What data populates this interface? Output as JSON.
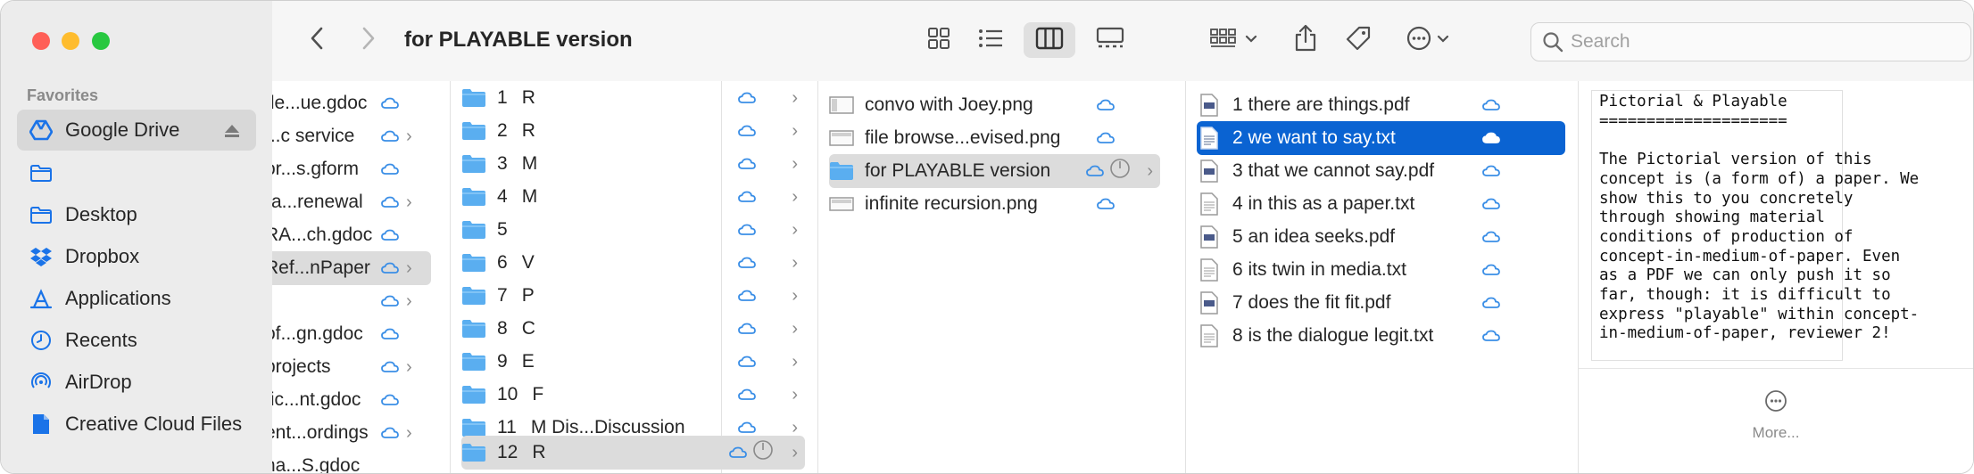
{
  "window": {
    "title": "for PLAYABLE version"
  },
  "search": {
    "placeholder": "Search"
  },
  "toolbar": {
    "back_icon": "chevron-left-icon",
    "forward_icon": "chevron-right-icon",
    "views": [
      "icon-view",
      "list-view",
      "column-view",
      "gallery-view"
    ],
    "selected_view": "column-view"
  },
  "sidebar": {
    "section": "Favorites",
    "items": [
      {
        "label": "Google Drive",
        "icon": "google-drive-icon"
      },
      {
        "label": "",
        "icon": "folder-icon"
      },
      {
        "label": "Desktop",
        "icon": "folder-icon"
      },
      {
        "label": "Dropbox",
        "icon": "dropbox-icon"
      },
      {
        "label": "Applications",
        "icon": "applications-icon"
      },
      {
        "label": "Recents",
        "icon": "clock-icon"
      },
      {
        "label": "AirDrop",
        "icon": "airdrop-icon"
      },
      {
        "label": "Creative Cloud Files",
        "icon": "document-icon"
      }
    ]
  },
  "columns": {
    "col1": [
      {
        "label": "fle...ue.gdoc"
      },
      {
        "label": "...c service"
      },
      {
        "label": "or...s.gform"
      },
      {
        "label": "ra...renewal"
      },
      {
        "label": "RA...ch.gdoc"
      },
      {
        "label": "Ref...nPaper"
      },
      {
        "label": ""
      },
      {
        "label": "of...gn.gdoc"
      },
      {
        "label": "projects"
      },
      {
        "label": "tic...nt.gdoc"
      },
      {
        "label": "ent...ordings"
      },
      {
        "label": "na...S.gdoc"
      }
    ],
    "col2": [
      {
        "num": "1",
        "label": "R"
      },
      {
        "num": "2",
        "label": "R"
      },
      {
        "num": "3",
        "label": "M"
      },
      {
        "num": "4",
        "label": "M"
      },
      {
        "num": "5",
        "label": ""
      },
      {
        "num": "6",
        "label": "V"
      },
      {
        "num": "7",
        "label": "P"
      },
      {
        "num": "8",
        "label": "C"
      },
      {
        "num": "9",
        "label": "E"
      },
      {
        "num": "10",
        "label": "F"
      },
      {
        "num": "11",
        "label": "M   Dis...Discussion"
      },
      {
        "num": "12",
        "label": "R"
      }
    ],
    "col3": [
      {
        "label": "convo with Joey.png"
      },
      {
        "label": "file browse...evised.png"
      },
      {
        "label": "for PLAYABLE version"
      },
      {
        "label": "infinite recursion.png"
      }
    ],
    "col4": [
      {
        "label": "1 there are things.pdf"
      },
      {
        "label": "2 we want to say.txt"
      },
      {
        "label": "3 that we cannot say.pdf"
      },
      {
        "label": "4 in this as a paper.txt"
      },
      {
        "label": "5 an idea seeks.pdf"
      },
      {
        "label": "6 its twin in media.txt"
      },
      {
        "label": "7 does the fit fit.pdf"
      },
      {
        "label": "8 is the dialogue legit.txt"
      }
    ]
  },
  "preview": {
    "text": "Pictorial & Playable\n====================\n\nThe Pictorial version of this\nconcept is (a form of) a paper. We\nshow this to you concretely\nthrough showing material\nconditions of production of\nconcept-in-medium-of-paper. Even\nas a PDF we can only push it so\nfar, though: it is difficult to\nexpress \"playable\" within concept-\nin-medium-of-paper, reviewer 2!",
    "more_label": "More..."
  },
  "colors": {
    "selection": "#0a63d2",
    "sidebar_bg": "#ececec",
    "folder": "#5aaef0",
    "cloud": "#3a8ee6"
  }
}
